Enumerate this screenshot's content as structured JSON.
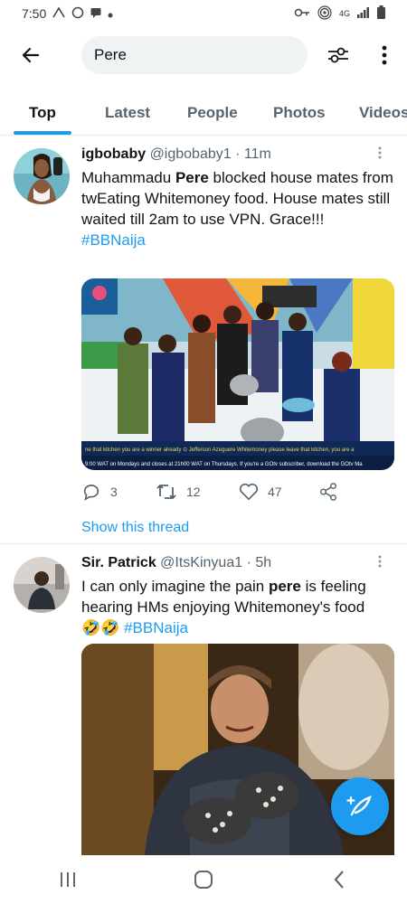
{
  "status_bar": {
    "time": "7:50",
    "icons_left": [
      "wifi-calling-icon",
      "whatsapp-icon",
      "message-icon",
      "dot-icon"
    ],
    "icons_right": [
      "key-icon",
      "hotspot-icon",
      "signal-icon",
      "battery-icon"
    ],
    "signal_text": "4G"
  },
  "search": {
    "query": "Pere"
  },
  "tabs": [
    {
      "label": "Top",
      "active": true
    },
    {
      "label": "Latest",
      "active": false
    },
    {
      "label": "People",
      "active": false
    },
    {
      "label": "Photos",
      "active": false
    },
    {
      "label": "Videos",
      "active": false
    }
  ],
  "tweets": [
    {
      "name": "igbobaby",
      "handle": "@igbobaby1",
      "time": "· 11m",
      "text_before": "Muhammadu ",
      "text_bold": "Pere",
      "text_after": " blocked house mates from twEating Whitemoney food. House mates still waited till 2am to use VPN. Grace!!!",
      "hashtag": "#BBNaija",
      "caption_line1": "ne that kitchen you are a winner already   ⊙ Jefferson Azeguere  Whitemoney please leave that kitchen, you are a",
      "caption_line2": "9:00 WAT on Mondays and closes at 21h00 WAT on Thursdays.  If you're a GOtv subscriber, download the GOtv Ma",
      "replies": "3",
      "retweets": "12",
      "likes": "47",
      "show_thread": "Show this thread"
    },
    {
      "name": "Sir. Patrick",
      "handle": "@ItsKinyua1",
      "time": "· 5h",
      "text_before": "I can only imagine the pain ",
      "text_bold": "pere",
      "text_after": " is feeling hearing HMs enjoying Whitemoney's food",
      "emoji": "🤣🤣",
      "hashtag": "#BBNaija"
    }
  ],
  "colors": {
    "accent": "#1d9bf0",
    "text_primary": "#0f1419",
    "text_secondary": "#536471"
  }
}
